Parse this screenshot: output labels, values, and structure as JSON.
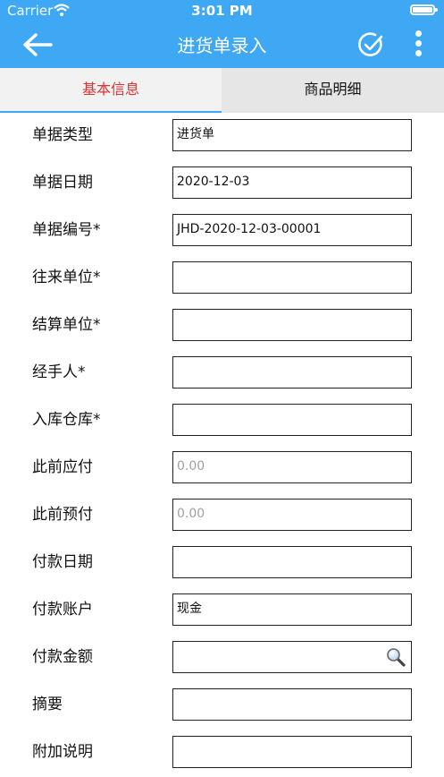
{
  "status_bar": {
    "carrier": "Carrier",
    "time": "3:01 PM"
  },
  "header": {
    "title": "进货单录入"
  },
  "tabs": [
    {
      "label": "基本信息",
      "active": true
    },
    {
      "label": "商品明细",
      "active": false
    }
  ],
  "form": {
    "fields": [
      {
        "label": "单据类型",
        "value": "进货单",
        "placeholder": ""
      },
      {
        "label": "单据日期",
        "value": "2020-12-03",
        "placeholder": ""
      },
      {
        "label": "单据编号*",
        "value": "JHD-2020-12-03-00001",
        "placeholder": ""
      },
      {
        "label": "往来单位*",
        "value": "",
        "placeholder": ""
      },
      {
        "label": "结算单位*",
        "value": "",
        "placeholder": ""
      },
      {
        "label": "经手人*",
        "value": "",
        "placeholder": ""
      },
      {
        "label": "入库仓库*",
        "value": "",
        "placeholder": ""
      },
      {
        "label": "此前应付",
        "value": "",
        "placeholder": "0.00"
      },
      {
        "label": "此前预付",
        "value": "",
        "placeholder": "0.00"
      },
      {
        "label": "付款日期",
        "value": "",
        "placeholder": ""
      },
      {
        "label": "付款账户",
        "value": "现金",
        "placeholder": ""
      },
      {
        "label": "付款金额",
        "value": "",
        "placeholder": ""
      },
      {
        "label": "摘要",
        "value": "",
        "placeholder": ""
      },
      {
        "label": "附加说明",
        "value": "",
        "placeholder": ""
      }
    ]
  },
  "colors": {
    "header_bg": "#3ea8f5",
    "active_tab_text": "#e0322f",
    "tab_bar_bg": "#e6e6e6"
  },
  "icons": [
    "back-arrow-icon",
    "check-circle-icon",
    "more-vertical-icon",
    "search-icon",
    "wifi-icon",
    "battery-icon"
  ]
}
